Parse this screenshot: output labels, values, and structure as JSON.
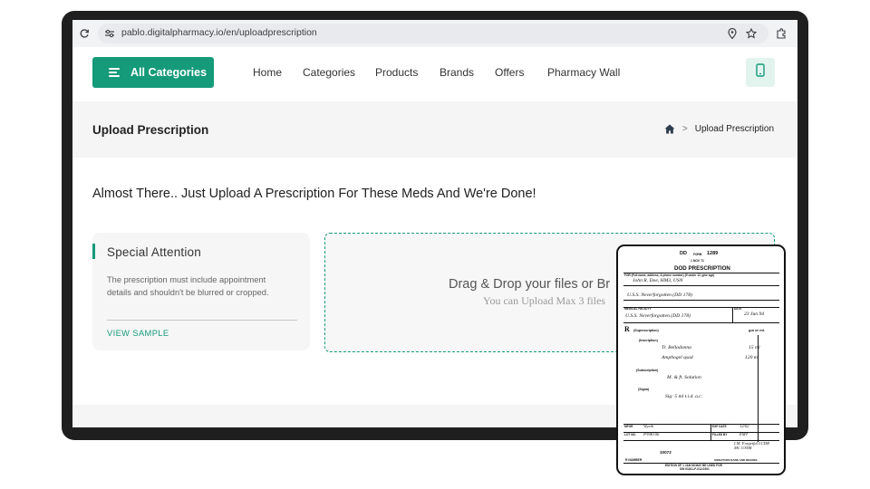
{
  "browser": {
    "url": "pablo.digitalpharmacy.io/en/uploadprescription",
    "reload_icon": "reload-icon",
    "site_settings_icon": "tune-icon",
    "location_icon": "location-pin-icon",
    "bookmark_icon": "star-icon",
    "extensions_icon": "puzzle-icon"
  },
  "nav": {
    "all_categories": "All Categories",
    "links": [
      "Home",
      "Categories",
      "Products",
      "Brands",
      "Offers",
      "Pharmacy Wall"
    ],
    "phone_icon": "mobile-phone-icon"
  },
  "header": {
    "title": "Upload Prescription",
    "breadcrumb_current": "Upload Prescription",
    "home_icon": "home-icon",
    "separator": ">"
  },
  "main": {
    "headline": "Almost There.. Just Upload A Prescription For These Meds And We're Done!",
    "card": {
      "title": "Special Attention",
      "body": "The prescription must include appointment details and shouldn't be blurred or cropped.",
      "link": "VIEW SAMPLE"
    },
    "dropzone": {
      "title": "Drag & Drop your files or Br",
      "subtitle": "You can Upload Max 3 files"
    }
  },
  "sample": {
    "dd": "DD",
    "form_label": "FORM",
    "form_no": "1289",
    "date_line": "1 NOV 71",
    "heading": "DOD PRESCRIPTION",
    "for_label": "FOR (Full name, address, & phone number) (If under 12, give age)",
    "patient": "John R. Doe, HM3, USN",
    "unit": "U.S.S. Neverforgotten (DD 178)",
    "facility_label": "MEDICAL FACILITY",
    "facility": "U.S.S. Neverforgotten (DD 178)",
    "date_label": "DATE",
    "date": "23 Jun 94",
    "rx_symbol": "R",
    "superscription": "(Superscription)",
    "gm_label": "gm or ml.",
    "inscription": "(Inscription)",
    "drug1": "Tr. Belladonna",
    "qty1": "15 ml",
    "drug2": "Amphogel qsad",
    "qty2": "120 ml",
    "subscription": "(Subscription)",
    "sub_text": "M. & ft. Solution",
    "signa": "(Signa)",
    "sig_text": "Sig: 5 ml t.i.d. a.c.",
    "mfgr_label": "MFGR",
    "mfgr": "Wyeth",
    "exp_label": "EXP DATE",
    "exp": "12/02",
    "lot_label": "LOT NO.",
    "lot": "P39K106",
    "filled_label": "FILLED BY",
    "filled": "EMT",
    "rx_no_label": "R NUMBER",
    "rx_no": "10072",
    "signature_block": "I.M. Forgetful LCDR MC USNR",
    "signature_label": "SIGNATURE   RANK   AND DEGREE",
    "edition": "EDITION OF 1 JAN 68 MAY BE USED  FOR",
    "sn": "S/N 0102-LF-012-0201"
  }
}
